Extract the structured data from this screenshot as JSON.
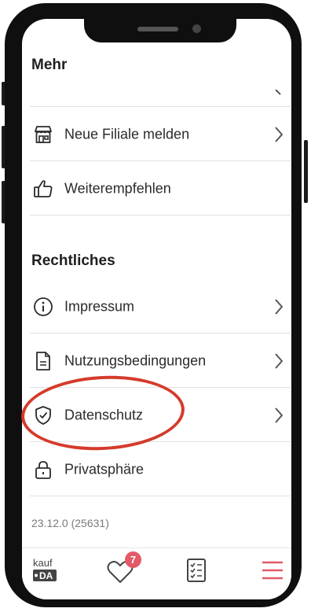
{
  "section_more": {
    "title": "Mehr"
  },
  "more_items": [
    {
      "label": "Neue Filiale melden",
      "icon": "store-icon"
    },
    {
      "label": "Weiterempfehlen",
      "icon": "thumbs-up-icon"
    }
  ],
  "section_legal": {
    "title": "Rechtliches"
  },
  "legal_items": [
    {
      "label": "Impressum",
      "icon": "info-icon"
    },
    {
      "label": "Nutzungsbedingungen",
      "icon": "document-icon"
    },
    {
      "label": "Datenschutz",
      "icon": "shield-check-icon"
    },
    {
      "label": "Privatsphäre",
      "icon": "lock-icon"
    }
  ],
  "version": "23.12.0 (25631)",
  "tabbar": {
    "logo_line1": "kauf",
    "logo_line2": "DA",
    "favorites_badge": "7"
  },
  "colors": {
    "accent": "#e35a68",
    "annotation": "#d43b2b",
    "text": "#2b2b2b"
  }
}
